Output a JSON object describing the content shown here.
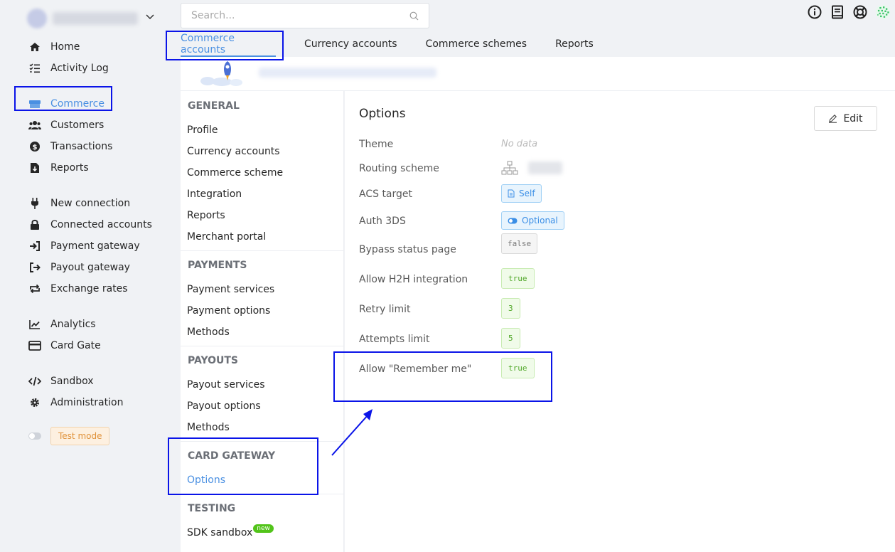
{
  "sidebar": {
    "items": [
      {
        "label": "Home",
        "icon": "home-icon"
      },
      {
        "label": "Activity Log",
        "icon": "list-check-icon"
      },
      {
        "label": "Commerce",
        "icon": "store-icon"
      },
      {
        "label": "Customers",
        "icon": "users-icon"
      },
      {
        "label": "Transactions",
        "icon": "dollar-circle-icon"
      },
      {
        "label": "Reports",
        "icon": "file-download-icon"
      },
      {
        "label": "New connection",
        "icon": "plug-icon"
      },
      {
        "label": "Connected accounts",
        "icon": "lock-icon"
      },
      {
        "label": "Payment gateway",
        "icon": "sign-in-icon"
      },
      {
        "label": "Payout gateway",
        "icon": "sign-out-icon"
      },
      {
        "label": "Exchange rates",
        "icon": "exchange-icon"
      },
      {
        "label": "Analytics",
        "icon": "chart-line-icon"
      },
      {
        "label": "Card Gate",
        "icon": "credit-card-icon"
      },
      {
        "label": "Sandbox",
        "icon": "code-icon"
      },
      {
        "label": "Administration",
        "icon": "gear-icon"
      }
    ],
    "test_mode": "Test mode"
  },
  "header": {
    "search_placeholder": "Search..."
  },
  "tabs": [
    {
      "label": "Commerce accounts"
    },
    {
      "label": "Currency accounts"
    },
    {
      "label": "Commerce schemes"
    },
    {
      "label": "Reports"
    }
  ],
  "menu": {
    "general": "GENERAL",
    "general_items": [
      "Profile",
      "Currency accounts",
      "Commerce scheme",
      "Integration",
      "Reports",
      "Merchant portal"
    ],
    "payments": "PAYMENTS",
    "payments_items": [
      "Payment services",
      "Payment options",
      "Methods"
    ],
    "payouts": "PAYOUTS",
    "payouts_items": [
      "Payout services",
      "Payout options",
      "Methods"
    ],
    "card_gateway": "CARD GATEWAY",
    "card_gateway_items": [
      "Options"
    ],
    "testing": "TESTING",
    "testing_items": [
      "SDK sandbox"
    ],
    "new_badge": "new"
  },
  "content": {
    "title": "Options",
    "edit_label": "Edit",
    "rows": [
      {
        "label": "Theme",
        "value": "No data"
      },
      {
        "label": "Routing scheme",
        "value": ""
      },
      {
        "label": "ACS target",
        "value": "Self"
      },
      {
        "label": "Auth 3DS",
        "value": "Optional"
      },
      {
        "label": "Bypass status page",
        "value": "false"
      },
      {
        "label": "Allow H2H integration",
        "value": "true"
      },
      {
        "label": "Retry limit",
        "value": "3"
      },
      {
        "label": "Attempts limit",
        "value": "5"
      },
      {
        "label": "Allow \"Remember me\"",
        "value": "true"
      }
    ]
  },
  "colors": {
    "accent": "#4a90e2",
    "annotation": "#0a14e8",
    "success": "#52c41a"
  }
}
